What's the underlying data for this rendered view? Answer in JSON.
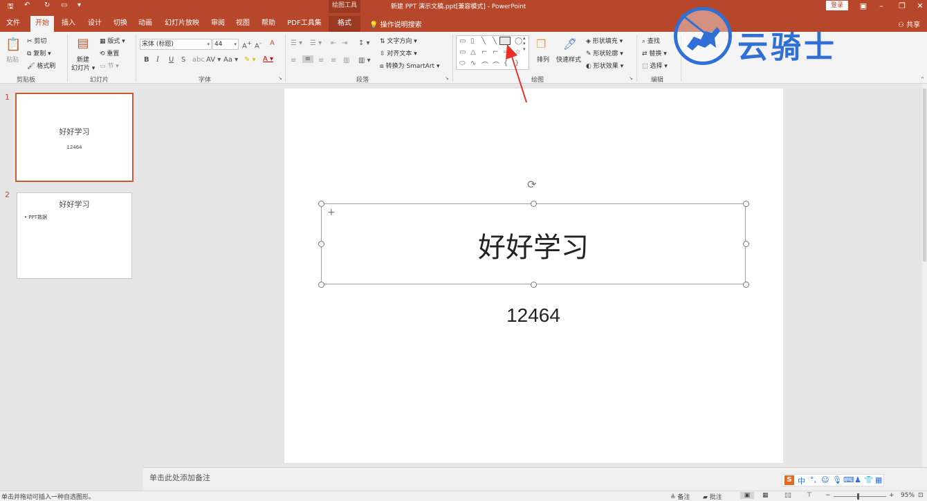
{
  "titlebar": {
    "context_tools": "绘图工具",
    "document_title": "新建 PPT 演示文稿.ppt[兼容模式]  -  PowerPoint",
    "login": "登录"
  },
  "tabs": [
    {
      "label": "文件"
    },
    {
      "label": "开始"
    },
    {
      "label": "插入"
    },
    {
      "label": "设计"
    },
    {
      "label": "切换"
    },
    {
      "label": "动画"
    },
    {
      "label": "幻灯片放映"
    },
    {
      "label": "审阅"
    },
    {
      "label": "视图"
    },
    {
      "label": "帮助"
    },
    {
      "label": "PDF工具集"
    },
    {
      "label": "格式"
    }
  ],
  "tell_me": "操作说明搜索",
  "share": "共享",
  "ribbon": {
    "clipboard": {
      "paste": "粘贴",
      "cut": "剪切",
      "copy": "复制",
      "format_painter": "格式刷",
      "label": "剪贴板"
    },
    "slides": {
      "new_slide_1": "新建",
      "new_slide_2": "幻灯片",
      "layout": "版式",
      "reset": "重置",
      "section": "节",
      "label": "幻灯片"
    },
    "font": {
      "name": "宋体 (标题)",
      "size": "44",
      "label": "字体"
    },
    "paragraph": {
      "text_direction": "文字方向",
      "align_text": "对齐文本",
      "smartart": "转换为 SmartArt",
      "label": "段落"
    },
    "drawing": {
      "arrange": "排列",
      "quick_styles": "快速样式",
      "shape_fill": "形状填充",
      "shape_outline": "形状轮廓",
      "shape_effects": "形状效果",
      "label": "绘图"
    },
    "editing": {
      "find": "查找",
      "replace": "替换",
      "select": "选择",
      "label": "编辑"
    }
  },
  "logo_text": "云骑士",
  "thumbnails": [
    {
      "num": "1",
      "title": "好好学习",
      "sub": "12464"
    },
    {
      "num": "2",
      "title": "好好学习",
      "bullet": "• PPT数据"
    }
  ],
  "slide": {
    "title": "好好学习",
    "subtitle": "12464"
  },
  "notes_placeholder": "单击此处添加备注",
  "status": {
    "message": "单击并拖动可插入一种自选图形。",
    "notes": "备注",
    "comments": "批注",
    "zoom": "95%"
  },
  "ime": {
    "logo": "S",
    "lang": "中"
  }
}
